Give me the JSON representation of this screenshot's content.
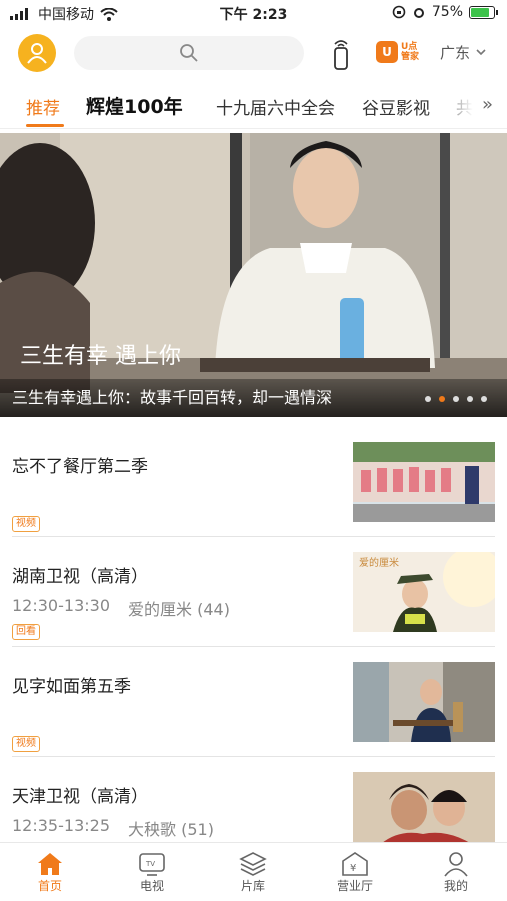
{
  "status": {
    "carrier": "中国移动",
    "time": "下午 2:23",
    "battery": "75%"
  },
  "header": {
    "region": "广东",
    "ubox_line1": "U点",
    "ubox_line2": "管家"
  },
  "tabs": [
    "推荐",
    "辉煌100年",
    "十九届六中全会",
    "谷豆影视",
    "共"
  ],
  "banner": {
    "caption": "三生有幸遇上你：故事千回百转，却一遇情深",
    "dots": 5,
    "active_dot": 1,
    "poster_text": "三生有幸 遇上你"
  },
  "items": [
    {
      "title": "忘不了餐厅第二季",
      "time": "",
      "program": "",
      "tag": "视频"
    },
    {
      "title": "湖南卫视（高清）",
      "time": "12:30-13:30",
      "program": "爱的厘米 (44)",
      "tag": "回看"
    },
    {
      "title": "见字如面第五季",
      "time": "",
      "program": "",
      "tag": "视频"
    },
    {
      "title": "天津卫视（高清）",
      "time": "12:35-13:25",
      "program": "大秧歌 (51)",
      "tag": ""
    }
  ],
  "tabbar": [
    {
      "label": "首页",
      "icon": "home-icon"
    },
    {
      "label": "电视",
      "icon": "tv-icon"
    },
    {
      "label": "片库",
      "icon": "layers-icon"
    },
    {
      "label": "营业厅",
      "icon": "store-icon"
    },
    {
      "label": "我的",
      "icon": "user-icon"
    }
  ],
  "colors": {
    "accent": "#f07a1a",
    "avatar": "#f6b21f"
  }
}
